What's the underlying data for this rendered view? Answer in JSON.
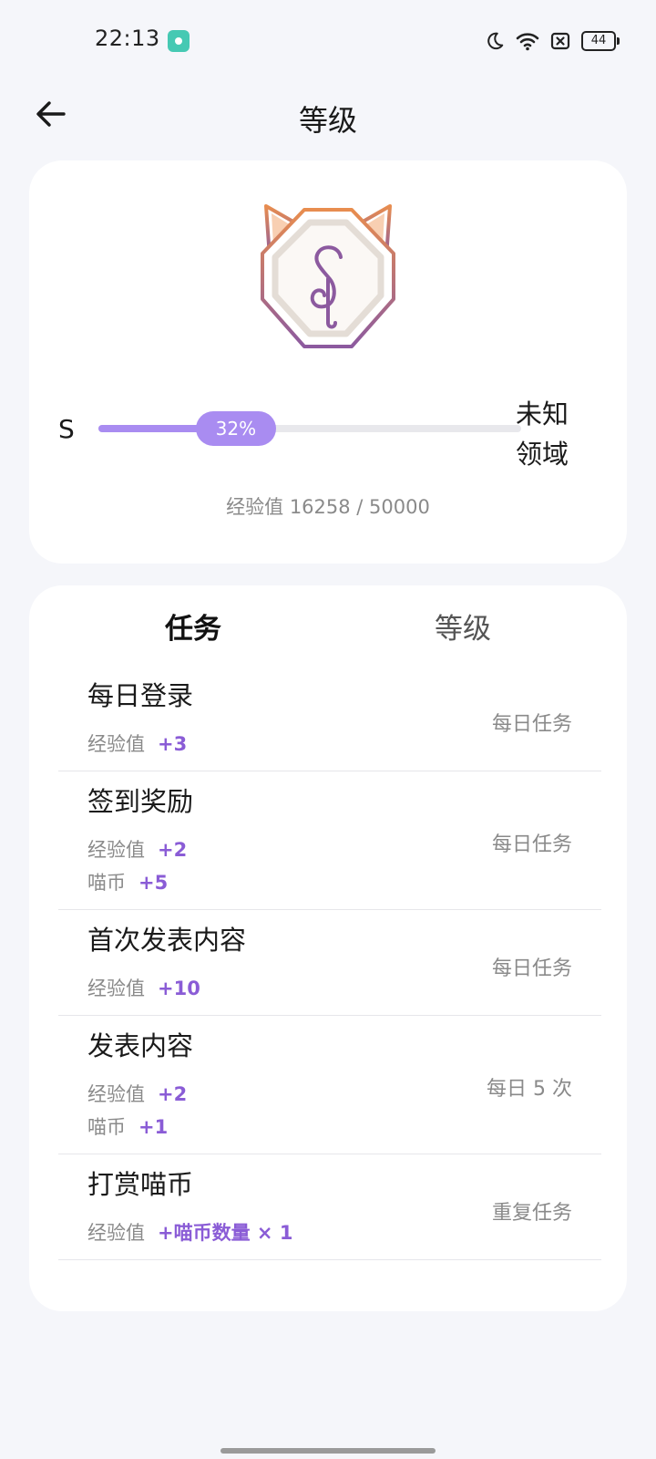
{
  "status_bar": {
    "time": "22:13",
    "battery": "44",
    "icons": [
      "app-notification-icon",
      "moon-icon",
      "wifi-icon",
      "no-sim-icon",
      "battery-icon"
    ]
  },
  "header": {
    "title": "等级",
    "back_icon": "arrow-left-icon"
  },
  "level_card": {
    "badge_letter": "S",
    "badge_colors": {
      "top": "#e88d4f",
      "bottom": "#8c5a9f"
    },
    "current_level": "S",
    "next_level": "未知\n领域",
    "progress_label": "32%",
    "progress_value": 0.3252,
    "exp_text": "经验值 16258 / 50000",
    "accent": "#a98cf1"
  },
  "tabs": [
    {
      "label": "任务",
      "active": true
    },
    {
      "label": "等级",
      "active": false
    }
  ],
  "tasks": [
    {
      "name": "每日登录",
      "rewards": [
        {
          "label": "经验值",
          "value": "+3"
        }
      ],
      "frequency": "每日任务"
    },
    {
      "name": "签到奖励",
      "rewards": [
        {
          "label": "经验值",
          "value": "+2"
        },
        {
          "label": "喵币",
          "value": "+5"
        }
      ],
      "frequency": "每日任务"
    },
    {
      "name": "首次发表内容",
      "rewards": [
        {
          "label": "经验值",
          "value": "+10"
        }
      ],
      "frequency": "每日任务"
    },
    {
      "name": "发表内容",
      "rewards": [
        {
          "label": "经验值",
          "value": "+2"
        },
        {
          "label": "喵币",
          "value": "+1"
        }
      ],
      "frequency": "每日 5 次"
    },
    {
      "name": "打赏喵币",
      "rewards": [
        {
          "label": "经验值",
          "value": "+喵币数量 × 1"
        }
      ],
      "frequency": "重复任务"
    }
  ],
  "colors": {
    "reward_value": "#8a5cd6",
    "background": "#f5f6fa"
  }
}
